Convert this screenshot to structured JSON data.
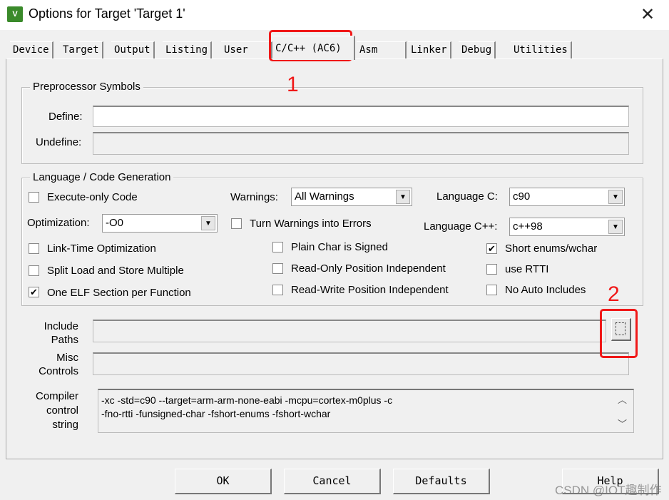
{
  "window": {
    "title": "Options for Target 'Target 1'",
    "icon": "keil-uvision-icon"
  },
  "tabs": [
    {
      "label": "Device"
    },
    {
      "label": "Target"
    },
    {
      "label": "Output"
    },
    {
      "label": "Listing"
    },
    {
      "label": "User"
    },
    {
      "label": "C/C++ (AC6)",
      "active": true
    },
    {
      "label": "Asm"
    },
    {
      "label": "Linker"
    },
    {
      "label": "Debug"
    },
    {
      "label": "Utilities"
    }
  ],
  "preprocessor": {
    "title": "Preprocessor Symbols",
    "define_label": "Define:",
    "define_value": "",
    "undefine_label": "Undefine:",
    "undefine_value": ""
  },
  "language": {
    "title": "Language / Code Generation",
    "execute_only": {
      "label": "Execute-only Code",
      "checked": false
    },
    "optimization_label": "Optimization:",
    "optimization_value": "-O0",
    "link_time": {
      "label": "Link-Time Optimization",
      "checked": false
    },
    "split_load": {
      "label": "Split Load and Store Multiple",
      "checked": false
    },
    "one_elf": {
      "label": "One ELF Section per Function",
      "checked": true
    },
    "warnings_label": "Warnings:",
    "warnings_value": "All Warnings",
    "turn_warnings": {
      "label": "Turn Warnings into Errors",
      "checked": false
    },
    "plain_char": {
      "label": "Plain Char is Signed",
      "checked": false
    },
    "ro_pi": {
      "label": "Read-Only Position Independent",
      "checked": false
    },
    "rw_pi": {
      "label": "Read-Write Position Independent",
      "checked": false
    },
    "lang_c_label": "Language C:",
    "lang_c_value": "c90",
    "lang_cpp_label": "Language C++:",
    "lang_cpp_value": "c++98",
    "short_enums": {
      "label": "Short enums/wchar",
      "checked": true
    },
    "rtti": {
      "label": "use RTTI",
      "checked": false
    },
    "no_auto": {
      "label": "No Auto Includes",
      "checked": false
    }
  },
  "include": {
    "label1": "Include",
    "label2": "Paths",
    "value": ""
  },
  "misc": {
    "label1": "Misc",
    "label2": "Controls",
    "value": ""
  },
  "compiler": {
    "label1": "Compiler",
    "label2": "control",
    "label3": "string",
    "line1": "-xc -std=c90 --target=arm-arm-none-eabi -mcpu=cortex-m0plus -c",
    "line2": "-fno-rtti -funsigned-char -fshort-enums -fshort-wchar"
  },
  "buttons": {
    "ok": "OK",
    "cancel": "Cancel",
    "defaults": "Defaults",
    "help": "Help"
  },
  "annotations": {
    "one": "1",
    "two": "2",
    "color": "#f01818"
  },
  "watermark": "CSDN @IOT趣制作"
}
